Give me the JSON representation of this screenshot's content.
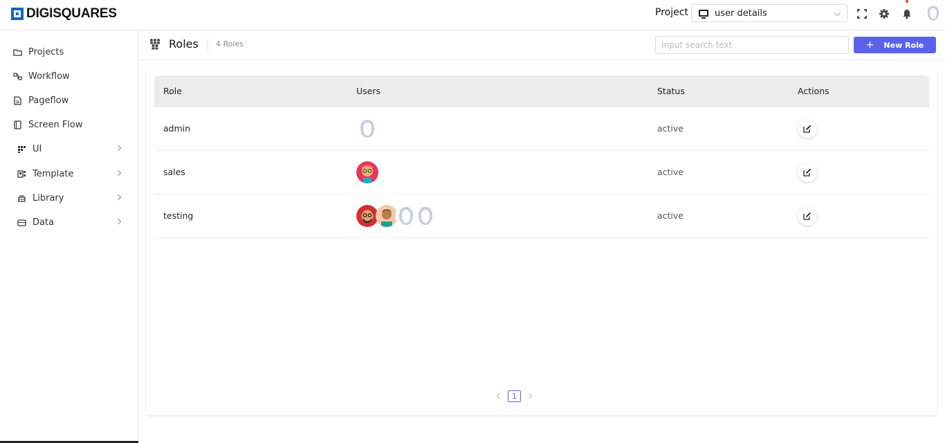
{
  "header": {
    "logo_text": "DIGISQUARES",
    "project_label": "Project",
    "project_value": "user details",
    "icons": [
      "fullscreen-icon",
      "gear-icon",
      "bell-icon",
      "avatar"
    ]
  },
  "sidebar": {
    "items": [
      {
        "label": "Projects",
        "icon": "folder-icon",
        "has_children": false
      },
      {
        "label": "Workflow",
        "icon": "workflow-icon",
        "has_children": false
      },
      {
        "label": "Pageflow",
        "icon": "page-icon",
        "has_children": false
      },
      {
        "label": "Screen Flow",
        "icon": "screen-icon",
        "has_children": false
      },
      {
        "label": "UI",
        "icon": "grid-icon",
        "has_children": true
      },
      {
        "label": "Template",
        "icon": "template-icon",
        "has_children": true
      },
      {
        "label": "Library",
        "icon": "library-icon",
        "has_children": true
      },
      {
        "label": "Data",
        "icon": "data-icon",
        "has_children": true
      }
    ]
  },
  "main": {
    "title": "Roles",
    "count": "4 Roles",
    "search_placeholder": "Input search text",
    "new_button_label": "New Role",
    "columns": [
      "Role",
      "Users",
      "Status",
      "Actions"
    ],
    "rows": [
      {
        "role": "admin",
        "status": "active",
        "users": [
          "placeholder"
        ]
      },
      {
        "role": "sales",
        "status": "active",
        "users": [
          "photo-glasses"
        ]
      },
      {
        "role": "testing",
        "status": "active",
        "users": [
          "photo-red",
          "photo-teal",
          "placeholder",
          "placeholder"
        ]
      }
    ],
    "pagination": {
      "current": "1"
    }
  },
  "colors": {
    "accent": "#5a63e8",
    "brand": "#1565c0"
  }
}
